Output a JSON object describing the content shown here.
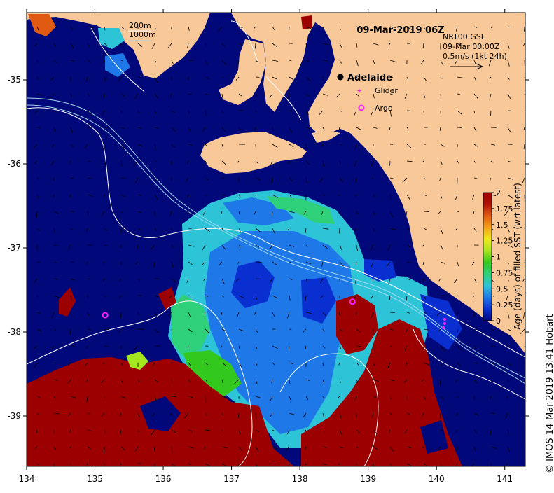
{
  "map": {
    "title": "09-Mar-2019 06Z",
    "credit": "© IMOS 14-Mar-2019 13:41 Hobart",
    "x_ticks": [
      "134",
      "135",
      "136",
      "137",
      "138",
      "139",
      "140",
      "141"
    ],
    "y_ticks": [
      "-35",
      "-36",
      "-37",
      "-38",
      "-39"
    ],
    "lon_range": [
      134,
      141.3
    ],
    "lat_range": [
      -39.6,
      -34.2
    ],
    "depth_legend": [
      "200m",
      "1000m"
    ],
    "current_info": [
      "NRT00 GSL",
      "09-Mar 00:00Z",
      "0.5m/s (1kt 24h)"
    ],
    "places": [
      {
        "label": "Adelaide",
        "lon": 138.6,
        "lat": -34.93
      },
      {
        "label": "Glider",
        "lon": 138.87,
        "lat": -35.1
      },
      {
        "label": "Argo",
        "lon": 138.87,
        "lat": -35.3
      }
    ],
    "argo_positions": [
      {
        "lon": 138.77,
        "lat": -37.64
      },
      {
        "lon": 135.15,
        "lat": -37.8
      }
    ],
    "glider_positions": [
      {
        "lon": 140.12,
        "lat": -37.85
      },
      {
        "lon": 140.12,
        "lat": -37.9
      },
      {
        "lon": 140.1,
        "lat": -37.95
      }
    ]
  },
  "colorbar": {
    "label": "Age (days) of filled SST (wrt latest)",
    "ticks": [
      "0",
      "0.25",
      "0.5",
      "0.75",
      "1",
      "1.25",
      "1.5",
      "1.75",
      "2"
    ],
    "range": [
      0,
      2
    ],
    "colors": [
      "#00087a",
      "#0a2fd0",
      "#1e78e8",
      "#2ec4d8",
      "#2fd07a",
      "#33c81e",
      "#a6e61e",
      "#f0e81c",
      "#f4a21a",
      "#e05a12",
      "#b01208",
      "#9c0000"
    ]
  },
  "colors": {
    "land": "#f8c898",
    "ocean_old": "#00087a",
    "river": "#ffffff"
  }
}
